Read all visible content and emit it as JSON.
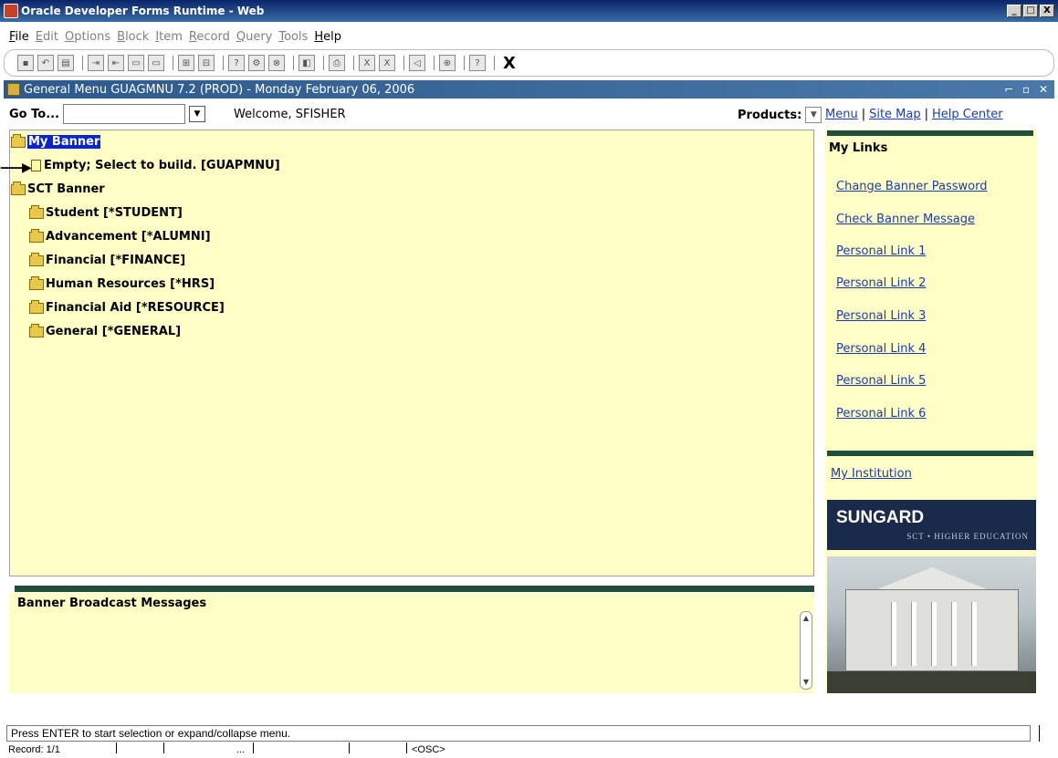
{
  "window": {
    "title": "Oracle Developer Forms Runtime - Web",
    "controls": [
      "_",
      "□",
      "X"
    ]
  },
  "menubar": [
    {
      "label": "File",
      "enabled": true
    },
    {
      "label": "Edit",
      "enabled": false
    },
    {
      "label": "Options",
      "enabled": false
    },
    {
      "label": "Block",
      "enabled": false
    },
    {
      "label": "Item",
      "enabled": false
    },
    {
      "label": "Record",
      "enabled": false
    },
    {
      "label": "Query",
      "enabled": false
    },
    {
      "label": "Tools",
      "enabled": false
    },
    {
      "label": "Help",
      "enabled": true
    }
  ],
  "toolbar": {
    "exit_label": "X"
  },
  "form": {
    "header": "General Menu  GUAGMNU  7.2  (PROD) - Monday February 06, 2006",
    "goto_label": "Go To...",
    "goto_value": "",
    "welcome": "Welcome, SFISHER",
    "products_label": "Products:"
  },
  "toplinks": {
    "menu": "Menu",
    "sitemap": "Site Map",
    "help": "Help Center"
  },
  "tree": {
    "items": [
      {
        "label": "My Banner",
        "icon": "folder-open-icon"
      },
      {
        "label": "Empty; Select to build. [GUAPMNU]",
        "icon": "document-icon"
      },
      {
        "label": "SCT Banner",
        "icon": "folder-open-icon"
      },
      {
        "label": "Student [*STUDENT]",
        "icon": "folder-icon"
      },
      {
        "label": "Advancement [*ALUMNI]",
        "icon": "folder-icon"
      },
      {
        "label": "Financial [*FINANCE]",
        "icon": "folder-icon"
      },
      {
        "label": "Human Resources [*HRS]",
        "icon": "folder-icon"
      },
      {
        "label": "Financial Aid [*RESOURCE]",
        "icon": "folder-icon"
      },
      {
        "label": "General [*GENERAL]",
        "icon": "folder-icon"
      }
    ]
  },
  "broadcast": {
    "title": "Banner Broadcast Messages"
  },
  "mylinks": {
    "title": "My Links",
    "links": [
      "Change Banner Password",
      "Check Banner Message",
      "Personal Link 1",
      "Personal Link 2",
      "Personal Link 3",
      "Personal Link 4",
      "Personal Link 5",
      "Personal Link 6"
    ],
    "institution": "My Institution"
  },
  "branding": {
    "brand": "SUNGARD",
    "tagline": "SCT • HIGHER EDUCATION"
  },
  "status": {
    "message": "Press ENTER to start selection or expand/collapse menu.",
    "record": "Record: 1/1",
    "ellipsis": "...",
    "mode": "<OSC>"
  },
  "colors": {
    "panel": "#ffffc6",
    "link": "#1a3ea8",
    "accent": "#1f4e3c"
  }
}
